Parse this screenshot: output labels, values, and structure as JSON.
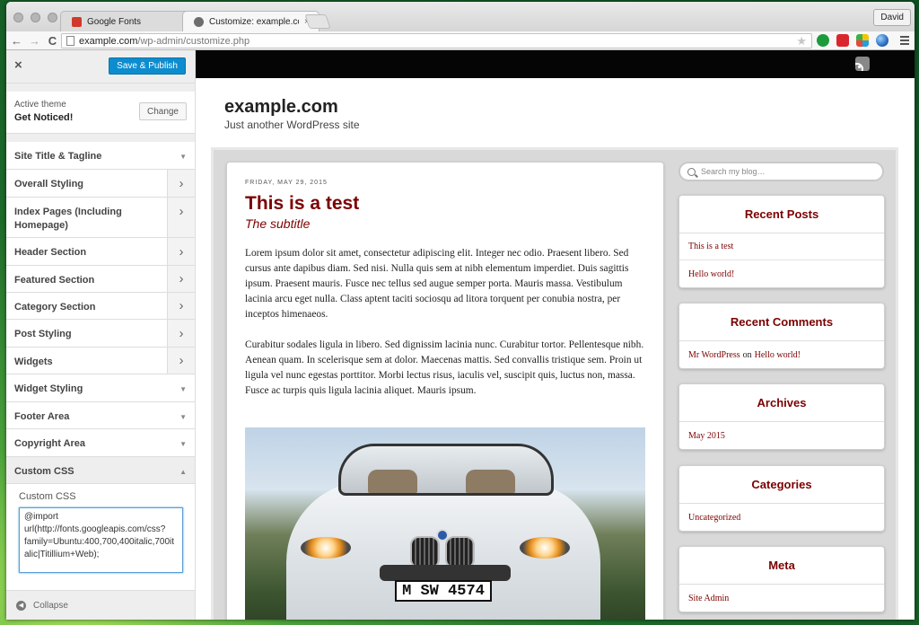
{
  "browser": {
    "tabs": [
      {
        "label": "Google Fonts",
        "close": "×",
        "favicon_color": "#d0392b"
      },
      {
        "label": "Customize: example.com |",
        "close": "×",
        "favicon_color": "#6d6d6d"
      }
    ],
    "user": "David",
    "url_host": "example.com",
    "url_path": "/wp-admin/customize.php",
    "nav": {
      "back": "←",
      "forward": "→",
      "reload": "C"
    },
    "star": "★",
    "extension_icons": [
      "hangouts-icon",
      "puzzle-icon",
      "pinwheel-icon",
      "globe-icon"
    ]
  },
  "customizer": {
    "close": "×",
    "save_label": "Save & Publish",
    "theme_label": "Active theme",
    "theme_name": "Get Noticed!",
    "change_label": "Change",
    "sections": [
      {
        "label": "Site Title & Tagline",
        "kind": "caret"
      },
      {
        "label": "Overall Styling",
        "kind": "chevron"
      },
      {
        "label": "Index Pages (Including Homepage)",
        "kind": "chevron"
      },
      {
        "label": "Header Section",
        "kind": "chevron"
      },
      {
        "label": "Featured Section",
        "kind": "chevron"
      },
      {
        "label": "Category Section",
        "kind": "chevron"
      },
      {
        "label": "Post Styling",
        "kind": "chevron"
      },
      {
        "label": "Widgets",
        "kind": "chevron"
      },
      {
        "label": "Widget Styling",
        "kind": "caret"
      },
      {
        "label": "Footer Area",
        "kind": "caret"
      },
      {
        "label": "Copyright Area",
        "kind": "caret"
      },
      {
        "label": "Custom CSS",
        "kind": "caret-up"
      }
    ],
    "custom_css_label": "Custom CSS",
    "custom_css_value": "@import url(http://fonts.googleapis.com/css?family=Ubuntu:400,700,400italic,700italic|Titillium+Web);",
    "collapse_label": "Collapse"
  },
  "preview": {
    "site_title": "example.com",
    "tagline": "Just another WordPress site",
    "post": {
      "date": "FRIDAY, MAY 29, 2015",
      "title": "This is a test",
      "subtitle": "The subtitle",
      "paragraphs": [
        "Lorem ipsum dolor sit amet, consectetur adipiscing elit. Integer nec odio. Praesent libero. Sed cursus ante dapibus diam. Sed nisi. Nulla quis sem at nibh elementum imperdiet. Duis sagittis ipsum. Praesent mauris. Fusce nec tellus sed augue semper porta. Mauris massa. Vestibulum lacinia arcu eget nulla. Class aptent taciti sociosqu ad litora torquent per conubia nostra, per inceptos himenaeos.",
        "Curabitur sodales ligula in libero. Sed dignissim lacinia nunc. Curabitur tortor. Pellentesque nibh. Aenean quam. In scelerisque sem at dolor. Maecenas mattis. Sed convallis tristique sem. Proin ut ligula vel nunc egestas porttitor. Morbi lectus risus, iaculis vel, suscipit quis, luctus non, massa. Fusce ac turpis quis ligula lacinia aliquet. Mauris ipsum."
      ],
      "plate": "M SW 4574"
    },
    "search_placeholder": "Search my blog…",
    "widgets": {
      "recent_posts": {
        "title": "Recent Posts",
        "items": [
          "This is a test",
          "Hello world!"
        ]
      },
      "recent_comments": {
        "title": "Recent Comments",
        "author": "Mr WordPress",
        "on": "on",
        "post": "Hello world!"
      },
      "archives": {
        "title": "Archives",
        "items": [
          "May 2015"
        ]
      },
      "categories": {
        "title": "Categories",
        "items": [
          "Uncategorized"
        ]
      },
      "meta": {
        "title": "Meta",
        "items": [
          "Site Admin"
        ]
      }
    }
  },
  "colors": {
    "accent": "#0d8dcf",
    "post_red": "#7b0000",
    "desktop_green": "#2e7a30"
  }
}
